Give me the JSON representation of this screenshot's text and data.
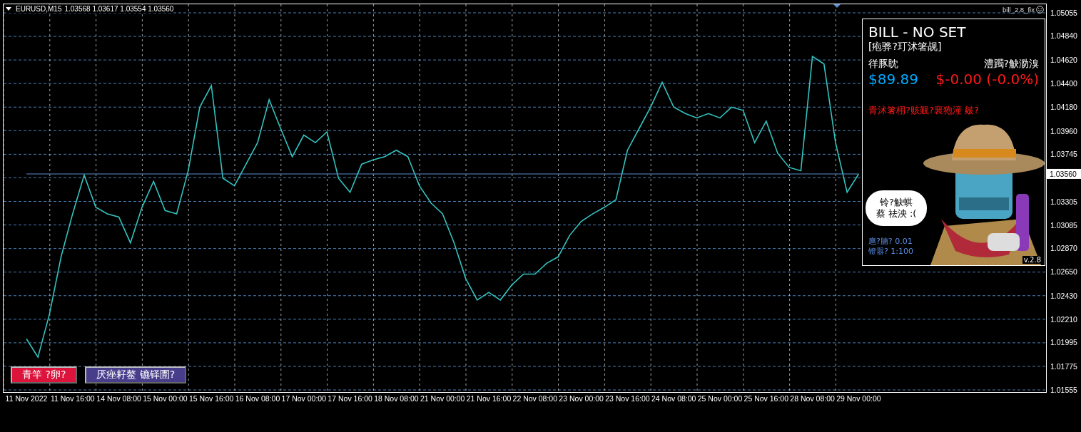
{
  "chart_header": {
    "symbol": "EURUSD,M15",
    "quotes": "1.03568 1.03617 1.03554 1.03560"
  },
  "indicator_label": "bill_2.8_fix",
  "current_price_label": "1.03560",
  "chart_data": {
    "type": "line",
    "grid": true,
    "categories": [
      "11 Nov 2022",
      null,
      null,
      null,
      "11 Nov 16:00",
      null,
      null,
      null,
      "14 Nov 08:00",
      null,
      null,
      null,
      "15 Nov 00:00",
      null,
      null,
      null,
      "15 Nov 16:00",
      null,
      null,
      null,
      "16 Nov 08:00",
      null,
      null,
      null,
      "17 Nov 00:00",
      null,
      null,
      null,
      "17 Nov 16:00",
      null,
      null,
      null,
      "18 Nov 08:00",
      null,
      null,
      null,
      "21 Nov 00:00",
      null,
      null,
      null,
      "21 Nov 16:00",
      null,
      null,
      null,
      "22 Nov 08:00",
      null,
      null,
      null,
      "23 Nov 00:00",
      null,
      null,
      null,
      "23 Nov 16:00",
      null,
      null,
      null,
      "24 Nov 08:00",
      null,
      null,
      null,
      "25 Nov 00:00",
      null,
      null,
      null,
      "25 Nov 16:00",
      null,
      null,
      null,
      "28 Nov 08:00",
      null,
      null,
      null,
      "29 Nov 00:00"
    ],
    "series": [
      {
        "color": "#33c3c0",
        "values": [
          1.0203,
          1.0186,
          1.0226,
          1.0279,
          1.0319,
          1.0355,
          1.0325,
          1.0319,
          1.0316,
          1.0292,
          1.0325,
          1.0349,
          1.0322,
          1.0319,
          1.0359,
          1.0418,
          1.0438,
          1.0352,
          1.0345,
          1.0365,
          1.0385,
          1.0425,
          1.0398,
          1.0372,
          1.0392,
          1.0385,
          1.0395,
          1.0352,
          1.0339,
          1.0365,
          1.0369,
          1.0372,
          1.0378,
          1.0372,
          1.0345,
          1.0329,
          1.0319,
          1.0292,
          1.0259,
          1.0239,
          1.0246,
          1.0239,
          1.0253,
          1.0263,
          1.0263,
          1.0273,
          1.0279,
          1.0299,
          1.0312,
          1.0319,
          1.0325,
          1.0332,
          1.0378,
          1.0398,
          1.0418,
          1.0441,
          1.0418,
          1.0412,
          1.0408,
          1.0412,
          1.0408,
          1.0418,
          1.0415,
          1.0385,
          1.0405,
          1.0375,
          1.0362,
          1.0359,
          1.0465,
          1.0458,
          1.0385,
          1.0339,
          1.0356
        ]
      },
      {
        "color": "#5b8fd0",
        "values": [
          1.0356,
          1.0356,
          1.0356,
          1.0356,
          1.0356,
          1.0356,
          1.0356,
          1.0356,
          1.0356,
          1.0356,
          1.0356,
          1.0356,
          1.0356,
          1.0356,
          1.0356,
          1.0356,
          1.0356,
          1.0356,
          1.0356,
          1.0356,
          1.0356,
          1.0356,
          1.0356,
          1.0356,
          1.0356,
          1.0356,
          1.0356,
          1.0356,
          1.0356,
          1.0356,
          1.0356,
          1.0356,
          1.0356,
          1.0356,
          1.0356,
          1.0356,
          1.0356,
          1.0356,
          1.0356,
          1.0356,
          1.0356,
          1.0356,
          1.0356,
          1.0356,
          1.0356,
          1.0356,
          1.0356,
          1.0356,
          1.0356,
          1.0356,
          1.0356,
          1.0356,
          1.0356,
          1.0356,
          1.0356,
          1.0356,
          1.0356,
          1.0356,
          1.0356,
          1.0356,
          1.0356,
          1.0356,
          1.0356,
          1.0356,
          1.0356,
          1.0356,
          1.0356,
          1.0356,
          1.0356,
          1.0356,
          1.0356,
          1.0356,
          1.0356
        ]
      }
    ],
    "ylim": [
      1.01555,
      1.05055
    ],
    "yticks": [
      {
        "value": 1.05055,
        "label": "1.05055"
      },
      {
        "value": 1.0484,
        "label": "1.04840"
      },
      {
        "value": 1.0462,
        "label": "1.04620"
      },
      {
        "value": 1.044,
        "label": "1.04400"
      },
      {
        "value": 1.0418,
        "label": "1.04180"
      },
      {
        "value": 1.0396,
        "label": "1.03960"
      },
      {
        "value": 1.03745,
        "label": "1.03745"
      },
      {
        "value": 1.03305,
        "label": "1.03305"
      },
      {
        "value": 1.03085,
        "label": "1.03085"
      },
      {
        "value": 1.0287,
        "label": "1.02870"
      },
      {
        "value": 1.0265,
        "label": "1.02650"
      },
      {
        "value": 1.0243,
        "label": "1.02430"
      },
      {
        "value": 1.0221,
        "label": "1.02210"
      },
      {
        "value": 1.01995,
        "label": "1.01995"
      },
      {
        "value": 1.01775,
        "label": "1.01775"
      },
      {
        "value": 1.01555,
        "label": "1.01555"
      }
    ]
  },
  "panel": {
    "title": "BILL - NO SET",
    "subtitle": "[疱骅?玎沭箸觇]",
    "balance_label": "徉豚眈",
    "balance": "$89.89",
    "profit_label": "澧躅?觖泐溴",
    "profit": "$-0.00 (-0.0%)",
    "message": "青沭箸栩?赅觐?襄狍潼 皴?",
    "bubble_lines": [
      "铃?觖蜞",
      "蔡 祛泱 :("
    ],
    "info_lines": [
      "扈?腩? 0.01",
      "镫嚣? 1:100"
    ],
    "version": "v.2.8"
  },
  "buttons": [
    {
      "label": "青竿  ?卵?",
      "color": "#dc143c"
    },
    {
      "label": "厌痤耔鳌 镳铎圊?",
      "color": "#483d8b"
    }
  ]
}
